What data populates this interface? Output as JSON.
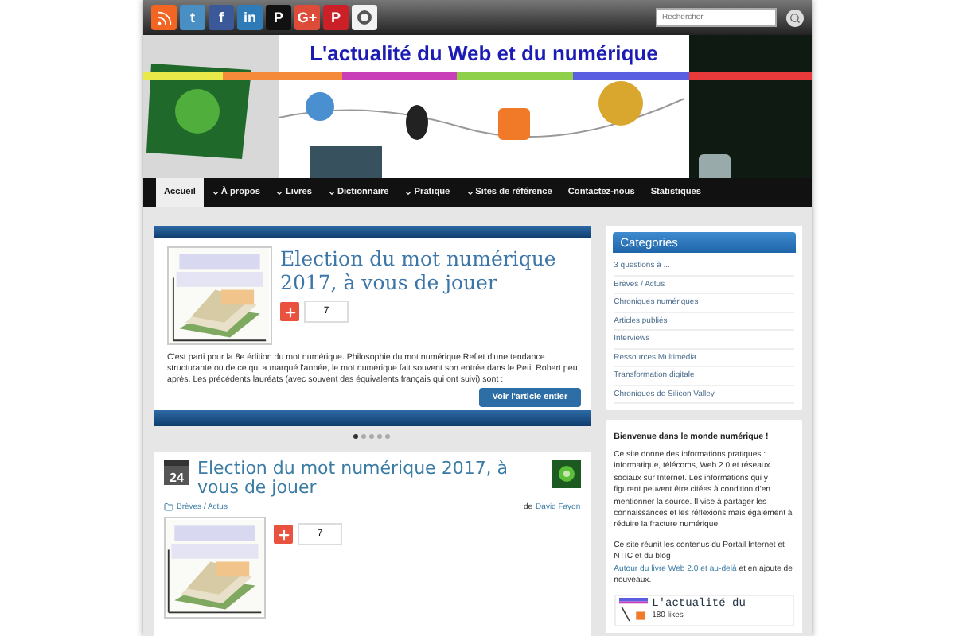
{
  "social_links": [
    {
      "kind": "rss",
      "color": "#f26522"
    },
    {
      "kind": "letter",
      "label": "t",
      "color": "#4a8fc4"
    },
    {
      "kind": "letter",
      "label": "f",
      "color": "#3b5998"
    },
    {
      "kind": "letter",
      "label": "in",
      "color": "#2e7bb8"
    },
    {
      "kind": "letter",
      "label": "P",
      "color": "#111111"
    },
    {
      "kind": "letter",
      "label": "G+",
      "color": "#dd4b39"
    },
    {
      "kind": "letter",
      "label": "P",
      "color": "#cb2027"
    },
    {
      "kind": "ring",
      "color": "#f2f2f2"
    }
  ],
  "search": {
    "placeholder": "Rechercher"
  },
  "banner": {
    "title": "L'actualité du Web et du numérique"
  },
  "nav": [
    {
      "label": "Accueil",
      "selected": true,
      "submenu": false
    },
    {
      "label": "À propos",
      "selected": false,
      "submenu": true
    },
    {
      "label": "Livres",
      "selected": false,
      "submenu": true
    },
    {
      "label": "Dictionnaire",
      "selected": false,
      "submenu": true
    },
    {
      "label": "Pratique",
      "selected": false,
      "submenu": true
    },
    {
      "label": "Sites de référence",
      "selected": false,
      "submenu": true
    },
    {
      "label": "Contactez-nous",
      "selected": false,
      "submenu": false
    },
    {
      "label": "Statistiques",
      "selected": false,
      "submenu": false
    }
  ],
  "slider": {
    "title": "Election du mot numérique 2017, à vous de jouer",
    "share_count": "7",
    "excerpt": "C'est parti pour la 8e édition du mot numérique. Philosophie du mot numérique Reflet d'une tendance structurante ou de ce qui a marqué l'année, le mot numérique fait souvent son entrée dans le Petit Robert peu après. Les précédents lauréats (avec souvent des équivalents français qui ont suivi) sont :",
    "button": "Voir l'article entier",
    "dots": [
      {
        "selected": true
      },
      {
        "selected": false
      },
      {
        "selected": false
      },
      {
        "selected": false
      },
      {
        "selected": false
      }
    ]
  },
  "article": {
    "day": "24",
    "title": "Election du mot numérique 2017, à vous de jouer",
    "category": "Brèves / Actus",
    "by": "de",
    "author": "David Fayon",
    "share_count": "7"
  },
  "sidebar": {
    "categories_title": "Categories",
    "categories": [
      "3 questions à ...",
      "Brèves / Actus",
      "Chroniques numériques",
      "Articles publiés",
      "Interviews",
      "Ressources Multimédia",
      "Transformation digitale",
      "Chroniques de Silicon Valley"
    ],
    "welcome_title": "Bienvenue dans le monde numérique !",
    "welcome_text": "Ce site donne des informations pratiques : informatique, télécoms, Web 2.0 et réseaux sociaux sur Internet. Les informations qui y figurent peuvent être citées à condition d'en mentionner la source. Il vise à partager les connaissances et les réflexions mais également à réduire la fracture numérique.",
    "welcome_text2_before": "Ce site réunit les contenus du Portail Internet et NTIC et du blog",
    "welcome_link": "Autour du livre Web 2.0 et au-delà",
    "welcome_text2_after": "et en ajoute de nouveaux.",
    "fan_box": {
      "name": "L'actualité du",
      "likes": "180 likes"
    }
  }
}
